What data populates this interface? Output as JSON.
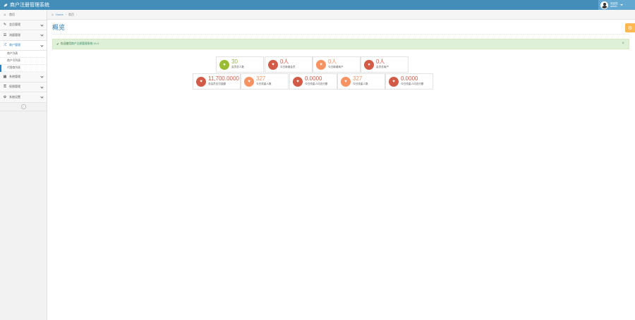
{
  "navbar": {
    "brand": "商户注册管理系统",
    "user_greeting": "欢迎您,",
    "user_name": "admin"
  },
  "sidebar": {
    "items": [
      {
        "label": "首页",
        "icon": "dashboard-icon"
      },
      {
        "label": "会员管理",
        "icon": "edit-icon"
      },
      {
        "label": "流量管理",
        "icon": "list-icon"
      },
      {
        "label": "商户管理",
        "icon": "random-icon"
      },
      {
        "label": "系统管理",
        "icon": "calendar-icon"
      },
      {
        "label": "权限管理",
        "icon": "lock-icon"
      },
      {
        "label": "系统设置",
        "icon": "settings-icon"
      }
    ],
    "subitems": [
      "商户列表",
      "商户号列表",
      "代理商列表"
    ],
    "collapse_symbol": "«"
  },
  "breadcrumbs": {
    "home": "Home",
    "current": "首页"
  },
  "page": {
    "title": "概览",
    "alert_prefix": "欢迎使用",
    "alert_highlight": "商户注册管理系统 V1.0",
    "alert_suffix": "",
    "close_symbol": "×"
  },
  "stats": [
    {
      "value": "30",
      "label": "会员总人数",
      "color": "#9abc32",
      "icon": "comments-icon"
    },
    {
      "value": "0人",
      "label": "今日新增会员",
      "color": "#d15b47",
      "icon": "twitter-icon"
    },
    {
      "value": "0人",
      "label": "今日新增商户",
      "color": "#f79263",
      "icon": "twitter-icon"
    },
    {
      "value": "0人",
      "label": "会员总商户",
      "color": "#d15b47",
      "icon": "comments-icon"
    },
    {
      "value": "11,700.0000",
      "label": "总会员支付金额",
      "color": "#d15b47",
      "icon": "twitter-icon"
    },
    {
      "value": "327",
      "label": "今日流量人数",
      "color": "#f79263",
      "icon": "twitter-icon"
    },
    {
      "value": "0.0000",
      "label": "今日流量人均支付额",
      "color": "#d15b47",
      "icon": "twitter-icon"
    },
    {
      "value": "327",
      "label": "今日流量人数",
      "color": "#f79263",
      "icon": "twitter-icon"
    },
    {
      "value": "0.0000",
      "label": "今日流量人均支付额",
      "color": "#d15b47",
      "icon": "twitter-icon"
    }
  ],
  "colors": {
    "navbar": "#438eb9",
    "accent": "#2679b5",
    "green": "#9abc32",
    "red": "#d15b47",
    "orange": "#f79263",
    "settings": "#ffb752"
  }
}
